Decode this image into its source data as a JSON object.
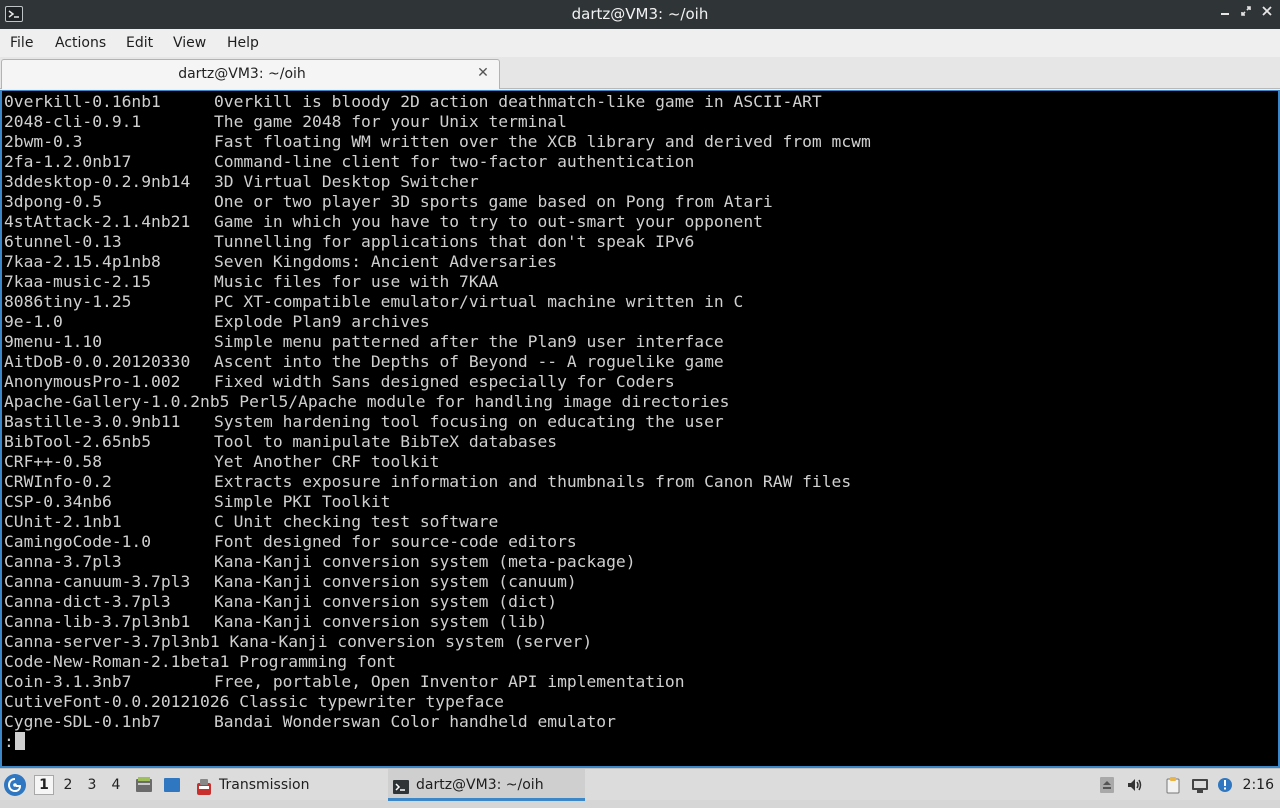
{
  "window": {
    "title": "dartz@VM3: ~/oih"
  },
  "menu": [
    "File",
    "Actions",
    "Edit",
    "View",
    "Help"
  ],
  "tabs": [
    {
      "label": "dartz@VM3: ~/oih"
    }
  ],
  "terminal": {
    "lines": [
      {
        "pkg": "0verkill-0.16nb1",
        "desc": "0verkill is bloody 2D action deathmatch-like game in ASCII-ART"
      },
      {
        "pkg": "2048-cli-0.9.1",
        "desc": "The game 2048 for your Unix terminal"
      },
      {
        "pkg": "2bwm-0.3",
        "desc": "Fast floating WM written over the XCB library and derived from mcwm"
      },
      {
        "pkg": "2fa-1.2.0nb17",
        "desc": "Command-line client for two-factor authentication"
      },
      {
        "pkg": "3ddesktop-0.2.9nb14",
        "desc": "3D Virtual Desktop Switcher"
      },
      {
        "pkg": "3dpong-0.5",
        "desc": "One or two player 3D sports game based on Pong from Atari"
      },
      {
        "pkg": "4stAttack-2.1.4nb21",
        "desc": "Game in which you have to try to out-smart your opponent"
      },
      {
        "pkg": "6tunnel-0.13",
        "desc": "Tunnelling for applications that don't speak IPv6"
      },
      {
        "pkg": "7kaa-2.15.4p1nb8",
        "desc": "Seven Kingdoms: Ancient Adversaries"
      },
      {
        "pkg": "7kaa-music-2.15",
        "desc": "Music files for use with 7KAA"
      },
      {
        "pkg": "8086tiny-1.25",
        "desc": "PC XT-compatible emulator/virtual machine written in C"
      },
      {
        "pkg": "9e-1.0",
        "desc": "Explode Plan9 archives"
      },
      {
        "pkg": "9menu-1.10",
        "desc": "Simple menu patterned after the Plan9 user interface"
      },
      {
        "pkg": "AitDoB-0.0.20120330",
        "desc": "Ascent into the Depths of Beyond -- A roguelike game"
      },
      {
        "pkg": "AnonymousPro-1.002",
        "desc": "Fixed width Sans designed especially for Coders"
      },
      {
        "pkg": "Apache-Gallery-1.0.2nb5",
        "desc": "Perl5/Apache module for handling image directories"
      },
      {
        "pkg": "Bastille-3.0.9nb11",
        "desc": "System hardening tool focusing on educating the user"
      },
      {
        "pkg": "BibTool-2.65nb5",
        "desc": "Tool to manipulate BibTeX databases"
      },
      {
        "pkg": "CRF++-0.58",
        "desc": "Yet Another CRF toolkit"
      },
      {
        "pkg": "CRWInfo-0.2",
        "desc": "Extracts exposure information and thumbnails from Canon RAW files"
      },
      {
        "pkg": "CSP-0.34nb6",
        "desc": "Simple PKI Toolkit"
      },
      {
        "pkg": "CUnit-2.1nb1",
        "desc": "C Unit checking test software"
      },
      {
        "pkg": "CamingoCode-1.0",
        "desc": "Font designed for source-code editors"
      },
      {
        "pkg": "Canna-3.7pl3",
        "desc": "Kana-Kanji conversion system (meta-package)"
      },
      {
        "pkg": "Canna-canuum-3.7pl3",
        "desc": "Kana-Kanji conversion system (canuum)"
      },
      {
        "pkg": "Canna-dict-3.7pl3",
        "desc": "Kana-Kanji conversion system (dict)"
      },
      {
        "pkg": "Canna-lib-3.7pl3nb1",
        "desc": "Kana-Kanji conversion system (lib)"
      },
      {
        "pkg": "Canna-server-3.7pl3nb1",
        "desc": "Kana-Kanji conversion system (server)"
      },
      {
        "pkg": "Code-New-Roman-2.1beta1",
        "desc": "Programming font"
      },
      {
        "pkg": "Coin-3.1.3nb7",
        "desc": "Free, portable, Open Inventor API implementation"
      },
      {
        "pkg": "CutiveFont-0.0.20121026",
        "desc": "Classic typewriter typeface"
      },
      {
        "pkg": "Cygne-SDL-0.1nb7",
        "desc": "Bandai Wonderswan Color handheld emulator"
      }
    ],
    "prompt": ":"
  },
  "taskbar": {
    "workspaces": [
      "1",
      "2",
      "3",
      "4"
    ],
    "active_workspace": "1",
    "tasks": [
      {
        "label": "Transmission",
        "icon": "transmission-icon"
      },
      {
        "label": "dartz@VM3: ~/oih",
        "icon": "terminal-icon",
        "active": true
      }
    ],
    "clock": "2:16"
  },
  "colors": {
    "terminal_bg": "#000000",
    "terminal_fg": "#d0d0d0",
    "accent": "#3c87c8",
    "titlebar_bg": "#2f3437"
  }
}
